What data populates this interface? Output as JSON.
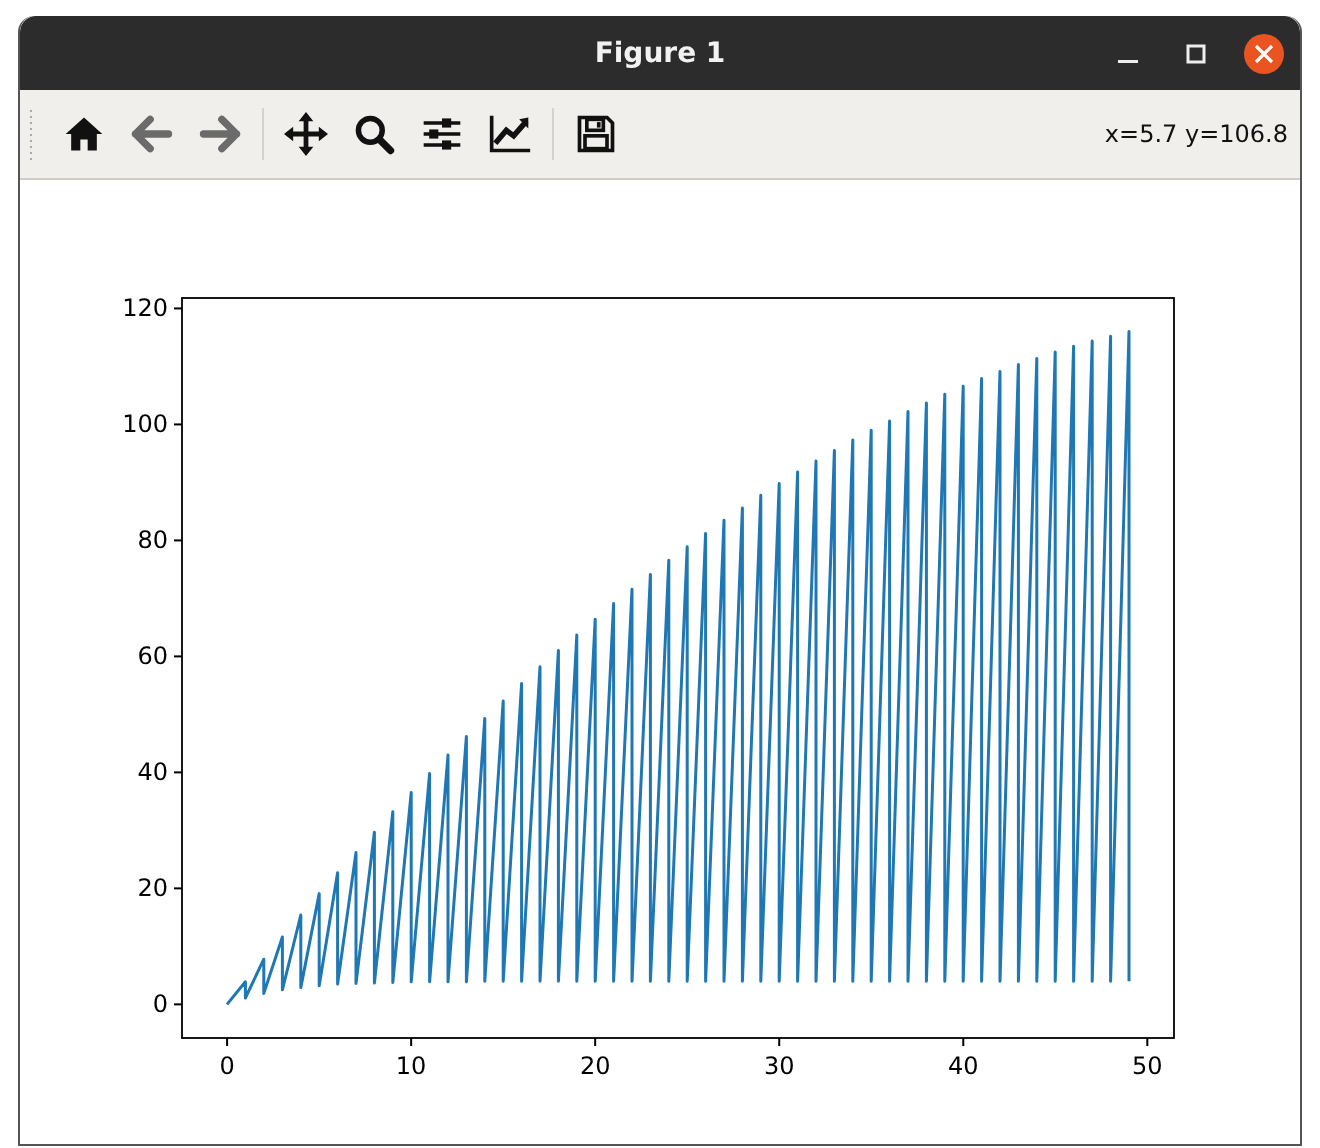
{
  "window": {
    "title": "Figure 1"
  },
  "window_controls": [
    {
      "kind": "minimize"
    },
    {
      "kind": "maximize"
    },
    {
      "kind": "close"
    }
  ],
  "toolbar": [
    {
      "kind": "home",
      "disabled": false
    },
    {
      "kind": "back",
      "disabled": true
    },
    {
      "kind": "forward",
      "disabled": true
    },
    {
      "kind": "separator"
    },
    {
      "kind": "pan",
      "disabled": false
    },
    {
      "kind": "zoom",
      "disabled": false
    },
    {
      "kind": "subplots",
      "disabled": false
    },
    {
      "kind": "axes",
      "disabled": false
    },
    {
      "kind": "separator"
    },
    {
      "kind": "save",
      "disabled": false
    }
  ],
  "coordinates": "x=5.7 y=106.8",
  "figure": {
    "chart_data": {
      "type": "line",
      "xlim": [
        -2.45,
        51.45
      ],
      "ylim": [
        -5.8,
        121.8
      ],
      "xticks": [
        0,
        10,
        20,
        30,
        40,
        50
      ],
      "yticks": [
        0,
        20,
        40,
        60,
        80,
        100,
        120
      ],
      "x": [
        0,
        1,
        1,
        2,
        2,
        3,
        3,
        4,
        4,
        5,
        5,
        6,
        6,
        7,
        7,
        8,
        8,
        9,
        9,
        10,
        10,
        11,
        11,
        12,
        12,
        13,
        13,
        14,
        14,
        15,
        15,
        16,
        16,
        17,
        17,
        18,
        18,
        19,
        19,
        20,
        20,
        21,
        21,
        22,
        22,
        23,
        23,
        24,
        24,
        25,
        25,
        26,
        26,
        27,
        27,
        28,
        28,
        29,
        29,
        30,
        30,
        31,
        31,
        32,
        32,
        33,
        33,
        34,
        34,
        35,
        35,
        36,
        36,
        37,
        37,
        38,
        38,
        39,
        39,
        40,
        40,
        41,
        41,
        42,
        42,
        43,
        43,
        44,
        44,
        45,
        45,
        46,
        46,
        47,
        47,
        48,
        48,
        49,
        49
      ],
      "series": [
        {
          "color": "#1f77b4",
          "values": [
            0,
            3.9,
            1.1,
            7.8,
            1.9,
            11.6,
            2.5,
            15.4,
            2.9,
            19.1,
            3.2,
            22.7,
            3.5,
            26.2,
            3.6,
            29.7,
            3.7,
            33.2,
            3.8,
            36.5,
            3.9,
            39.8,
            3.9,
            43.0,
            3.9,
            46.2,
            3.9,
            49.3,
            4.0,
            52.3,
            4.0,
            55.3,
            4.0,
            58.2,
            4.0,
            61.0,
            4.0,
            63.7,
            4.0,
            66.4,
            4.0,
            69.1,
            4.0,
            71.6,
            4.0,
            74.1,
            4.0,
            76.6,
            4.0,
            78.9,
            4.0,
            81.2,
            4.0,
            83.5,
            4.0,
            85.6,
            4.0,
            87.8,
            4.0,
            89.8,
            4.0,
            91.8,
            4.0,
            93.7,
            4.0,
            95.5,
            4.0,
            97.3,
            4.0,
            99.0,
            4.0,
            100.6,
            4.0,
            102.2,
            4.0,
            103.7,
            4.0,
            105.2,
            4.0,
            106.6,
            4.0,
            107.9,
            4.0,
            109.1,
            4.0,
            110.3,
            4.0,
            111.4,
            4.0,
            112.5,
            4.0,
            113.5,
            4.0,
            114.4,
            4.0,
            115.2,
            4.0,
            116.0,
            4.0
          ]
        }
      ]
    }
  }
}
